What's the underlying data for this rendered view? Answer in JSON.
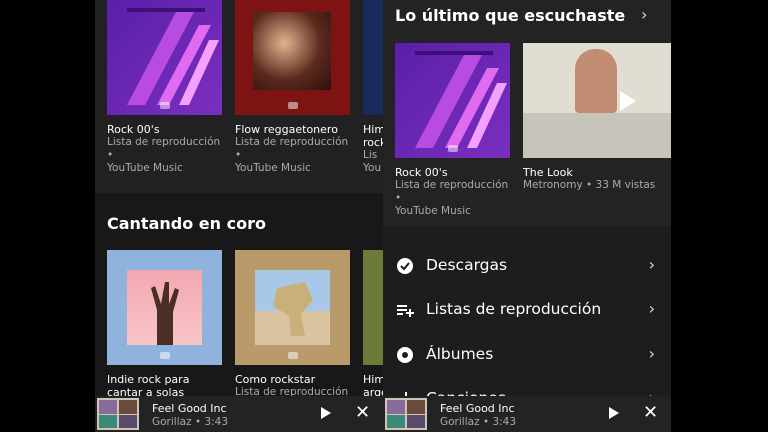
{
  "left": {
    "cards_top": [
      {
        "title": "Rock 00's",
        "sub1": "Lista de reproducción •",
        "sub2": "YouTube Music"
      },
      {
        "title": "Flow reggaetonero",
        "sub1": "Lista de reproducción •",
        "sub2": "YouTube Music"
      },
      {
        "title": "Him",
        "sub1": "rock",
        "sub2": "Lis",
        "sub3": "You"
      }
    ],
    "section_title": "Cantando en coro",
    "cards_bottom": [
      {
        "title": "Indie rock para cantar a solas"
      },
      {
        "title": "Como rockstar",
        "sub1": "Lista de reproducción •"
      },
      {
        "title": "Him",
        "sub1": "arge"
      }
    ]
  },
  "right": {
    "section_title": "Lo último que escuchaste",
    "cards": [
      {
        "title": "Rock 00's",
        "sub1": "Lista de reproducción •",
        "sub2": "YouTube Music"
      },
      {
        "title": "The Look",
        "sub1": "Metronomy • 33 M vistas"
      }
    ],
    "menu": [
      {
        "label": "Descargas",
        "icon": "download-check-icon"
      },
      {
        "label": "Listas de reproducción",
        "icon": "playlist-icon"
      },
      {
        "label": "Álbumes",
        "icon": "album-icon"
      },
      {
        "label": "Canciones",
        "icon": "music-note-icon"
      }
    ]
  },
  "mini_player": {
    "title": "Feel Good Inc",
    "subtitle": "Gorillaz • 3:43"
  },
  "colors": {
    "purple": "#7b2fbf",
    "magenta": "#c34ad8",
    "red": "#a01c1c",
    "blue": "#8fb3dd",
    "tan": "#b99a6a",
    "green": "#6b7b3a"
  }
}
